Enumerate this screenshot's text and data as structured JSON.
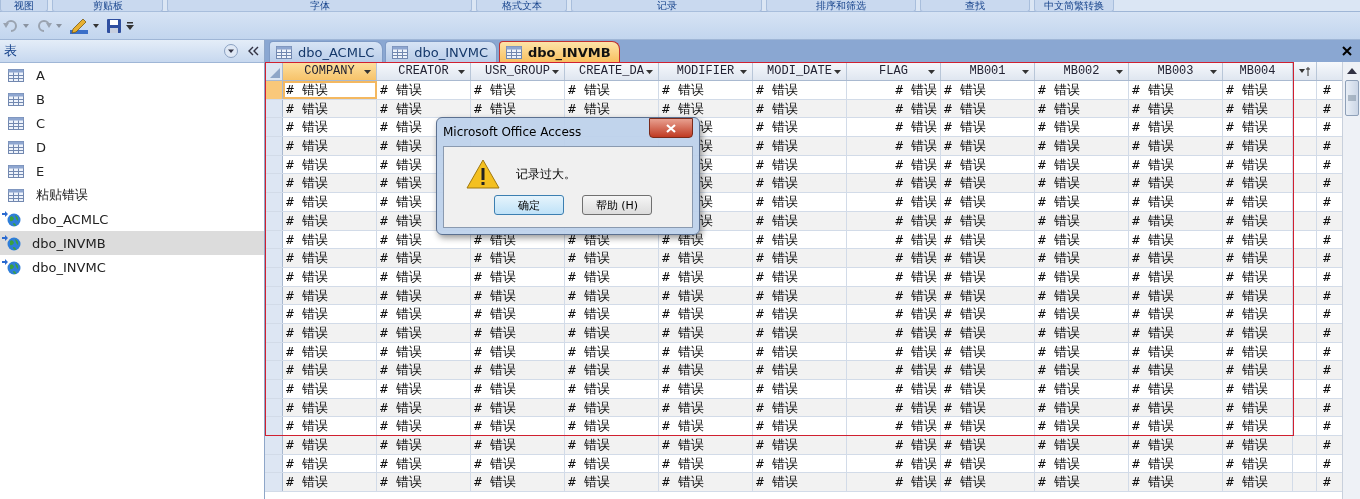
{
  "ribbon_groups": [
    "视图",
    "剪贴板",
    "字体",
    "格式文本",
    "记录",
    "排序和筛选",
    "查找",
    "中文简繁转换"
  ],
  "nav_pane": {
    "title": "表",
    "items": [
      {
        "label": "A",
        "kind": "table",
        "selected": false
      },
      {
        "label": "B",
        "kind": "table",
        "selected": false
      },
      {
        "label": "C",
        "kind": "table",
        "selected": false
      },
      {
        "label": "D",
        "kind": "table",
        "selected": false
      },
      {
        "label": "E",
        "kind": "table",
        "selected": false
      },
      {
        "label": "粘贴错误",
        "kind": "table",
        "selected": false
      },
      {
        "label": "dbo_ACMLC",
        "kind": "linked",
        "selected": false
      },
      {
        "label": "dbo_INVMB",
        "kind": "linked",
        "selected": true
      },
      {
        "label": "dbo_INVMC",
        "kind": "linked",
        "selected": false
      }
    ]
  },
  "tabs": [
    {
      "label": "dbo_ACMLC",
      "selected": false
    },
    {
      "label": "dbo_INVMC",
      "selected": false
    },
    {
      "label": "dbo_INVMB",
      "selected": true
    }
  ],
  "table": {
    "columns": [
      {
        "label": "COMPANY",
        "selected": true
      },
      {
        "label": "CREATOR",
        "selected": false
      },
      {
        "label": "USR_GROUP",
        "selected": false
      },
      {
        "label": "CREATE_DA",
        "selected": false
      },
      {
        "label": "MODIFIER",
        "selected": false
      },
      {
        "label": "MODI_DATE",
        "selected": false
      },
      {
        "label": "FLAG",
        "selected": false
      },
      {
        "label": "MB001",
        "selected": false
      },
      {
        "label": "MB002",
        "selected": false
      },
      {
        "label": "MB003",
        "selected": false
      },
      {
        "label": "MB004",
        "selected": false
      }
    ],
    "rows": [
      {
        "selected": true,
        "in_selection": true,
        "cells": [
          "# 错误",
          "# 错误",
          "# 错误",
          "# 错误",
          "# 错误",
          "# 错误",
          "# 错误",
          "# 错误",
          "# 错误",
          "# 错误",
          "# 错误",
          "#"
        ]
      },
      {
        "selected": false,
        "in_selection": true,
        "cells": [
          "# 错误",
          "# 错误",
          "# 错误",
          "# 错误",
          "# 错误",
          "# 错误",
          "# 错误",
          "# 错误",
          "# 错误",
          "# 错误",
          "# 错误",
          "#"
        ]
      },
      {
        "selected": false,
        "in_selection": true,
        "cells": [
          "# 错误",
          "# 错误",
          null,
          null,
          {
            "text": "误",
            "kind": "clipped"
          },
          "# 错误",
          "# 错误",
          "# 错误",
          "# 错误",
          "# 错误",
          "# 错误",
          "#"
        ]
      },
      {
        "selected": false,
        "in_selection": true,
        "cells": [
          "# 错误",
          "# 错误",
          null,
          null,
          {
            "text": "误",
            "kind": "clipped"
          },
          "# 错误",
          "# 错误",
          "# 错误",
          "# 错误",
          "# 错误",
          "# 错误",
          "#"
        ]
      },
      {
        "selected": false,
        "in_selection": true,
        "cells": [
          "# 错误",
          "# 错误",
          null,
          null,
          {
            "text": "误",
            "kind": "clipped"
          },
          "# 错误",
          "# 错误",
          "# 错误",
          "# 错误",
          "# 错误",
          "# 错误",
          "#"
        ]
      },
      {
        "selected": false,
        "in_selection": true,
        "cells": [
          "# 错误",
          "# 错误",
          null,
          null,
          {
            "text": "误",
            "kind": "clipped"
          },
          "# 错误",
          "# 错误",
          "# 错误",
          "# 错误",
          "# 错误",
          "# 错误",
          "#"
        ]
      },
      {
        "selected": false,
        "in_selection": true,
        "cells": [
          "# 错误",
          "# 错误",
          null,
          null,
          {
            "text": "误",
            "kind": "clipped"
          },
          "# 错误",
          "# 错误",
          "# 错误",
          "# 错误",
          "# 错误",
          "# 错误",
          "#"
        ]
      },
      {
        "selected": false,
        "in_selection": true,
        "cells": [
          "# 错误",
          "# 错误",
          null,
          null,
          {
            "text": "误",
            "kind": "clipped"
          },
          "# 错误",
          "# 错误",
          "# 错误",
          "# 错误",
          "# 错误",
          "# 错误",
          "#"
        ]
      },
      {
        "selected": false,
        "in_selection": true,
        "cells": [
          "# 错误",
          "# 错误",
          "# 错误",
          "# 错误",
          "# 错误",
          "# 错误",
          "# 错误",
          "# 错误",
          "# 错误",
          "# 错误",
          "# 错误",
          "#"
        ]
      },
      {
        "selected": false,
        "in_selection": true,
        "cells": [
          "# 错误",
          "# 错误",
          "# 错误",
          "# 错误",
          "# 错误",
          "# 错误",
          "# 错误",
          "# 错误",
          "# 错误",
          "# 错误",
          "# 错误",
          "#"
        ]
      },
      {
        "selected": false,
        "in_selection": true,
        "cells": [
          "# 错误",
          "# 错误",
          "# 错误",
          "# 错误",
          "# 错误",
          "# 错误",
          "# 错误",
          "# 错误",
          "# 错误",
          "# 错误",
          "# 错误",
          "#"
        ]
      },
      {
        "selected": false,
        "in_selection": true,
        "cells": [
          "# 错误",
          "# 错误",
          "# 错误",
          "# 错误",
          "# 错误",
          "# 错误",
          "# 错误",
          "# 错误",
          "# 错误",
          "# 错误",
          "# 错误",
          "#"
        ]
      },
      {
        "selected": false,
        "in_selection": true,
        "cells": [
          "# 错误",
          "# 错误",
          "# 错误",
          "# 错误",
          "# 错误",
          "# 错误",
          "# 错误",
          "# 错误",
          "# 错误",
          "# 错误",
          "# 错误",
          "#"
        ]
      },
      {
        "selected": false,
        "in_selection": true,
        "cells": [
          "# 错误",
          "# 错误",
          "# 错误",
          "# 错误",
          "# 错误",
          "# 错误",
          "# 错误",
          "# 错误",
          "# 错误",
          "# 错误",
          "# 错误",
          "#"
        ]
      },
      {
        "selected": false,
        "in_selection": true,
        "cells": [
          "# 错误",
          "# 错误",
          "# 错误",
          "# 错误",
          "# 错误",
          "# 错误",
          "# 错误",
          "# 错误",
          "# 错误",
          "# 错误",
          "# 错误",
          "#"
        ]
      },
      {
        "selected": false,
        "in_selection": true,
        "cells": [
          "# 错误",
          "# 错误",
          "# 错误",
          "# 错误",
          "# 错误",
          "# 错误",
          "# 错误",
          "# 错误",
          "# 错误",
          "# 错误",
          "# 错误",
          "#"
        ]
      },
      {
        "selected": false,
        "in_selection": true,
        "cells": [
          "# 错误",
          "# 错误",
          "# 错误",
          "# 错误",
          "# 错误",
          "# 错误",
          "# 错误",
          "# 错误",
          "# 错误",
          "# 错误",
          "# 错误",
          "#"
        ]
      },
      {
        "selected": false,
        "in_selection": true,
        "cells": [
          "# 错误",
          "# 错误",
          "# 错误",
          "# 错误",
          "# 错误",
          "# 错误",
          "# 错误",
          "# 错误",
          "# 错误",
          "# 错误",
          "# 错误",
          "#"
        ]
      },
      {
        "selected": false,
        "in_selection": true,
        "cells": [
          "# 错误",
          "# 错误",
          "# 错误",
          "# 错误",
          "# 错误",
          "# 错误",
          "# 错误",
          "# 错误",
          "# 错误",
          "# 错误",
          "# 错误",
          "#"
        ]
      },
      {
        "selected": false,
        "in_selection": false,
        "cells": [
          "# 错误",
          "# 错误",
          "# 错误",
          "# 错误",
          "# 错误",
          "# 错误",
          "# 错误",
          "# 错误",
          "# 错误",
          "# 错误",
          "# 错误",
          "#"
        ]
      },
      {
        "selected": false,
        "in_selection": false,
        "cells": [
          "# 错误",
          "# 错误",
          "# 错误",
          "# 错误",
          "# 错误",
          "# 错误",
          "# 错误",
          "# 错误",
          "# 错误",
          "# 错误",
          "# 错误",
          "#"
        ]
      },
      {
        "selected": false,
        "in_selection": false,
        "cells": [
          "# 错误",
          "# 错误",
          "# 错误",
          "# 错误",
          "# 错误",
          "# 错误",
          "# 错误",
          "# 错误",
          "# 错误",
          "# 错误",
          "# 错误",
          "#"
        ]
      }
    ]
  },
  "dialog": {
    "title": "Microsoft Office Access",
    "message": "记录过大。",
    "buttons": [
      {
        "label": "确定",
        "selected": true
      },
      {
        "label": "帮助 (H)",
        "selected": false
      }
    ]
  }
}
